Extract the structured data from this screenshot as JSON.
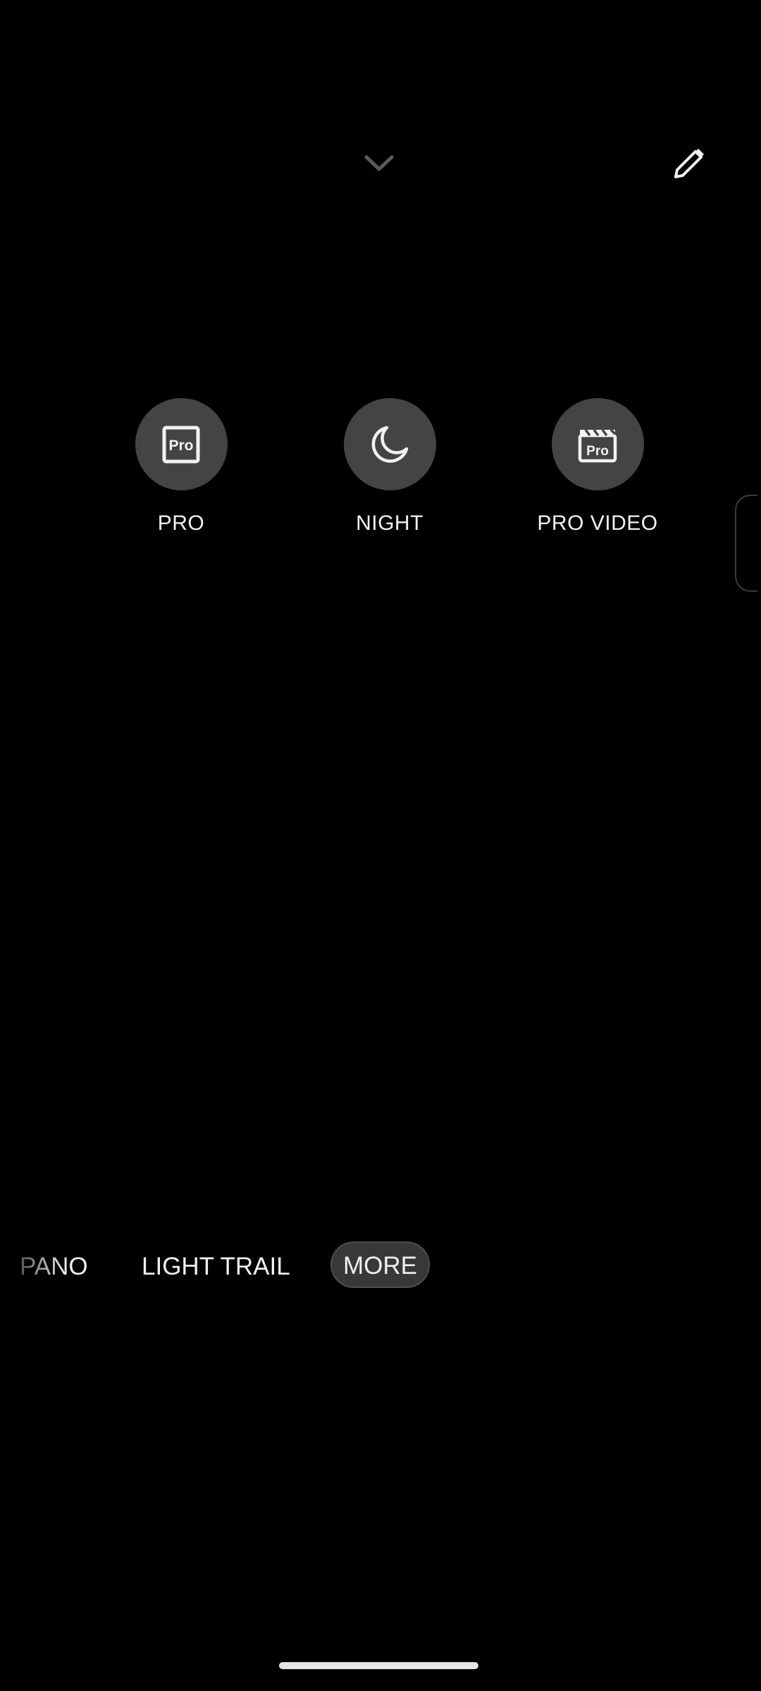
{
  "top_bar": {
    "collapse_icon": "chevron-down-icon",
    "edit_icon": "pencil-icon"
  },
  "modes": [
    {
      "label": "PRO",
      "icon": "pro-icon"
    },
    {
      "label": "NIGHT",
      "icon": "moon-icon"
    },
    {
      "label": "PRO VIDEO",
      "icon": "pro-video-clapper-icon"
    }
  ],
  "mode_strip": {
    "items": [
      "PANO",
      "LIGHT TRAIL",
      "MORE"
    ],
    "selected": "MORE"
  },
  "colors": {
    "background": "#000000",
    "mode_circle": "#444444",
    "selected_pill": "#383838",
    "text": "#f0f0f0"
  }
}
